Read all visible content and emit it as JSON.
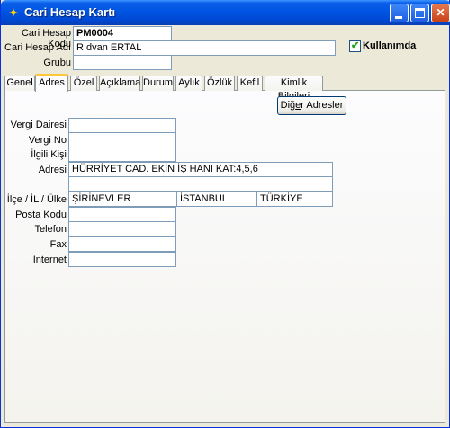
{
  "window": {
    "title": "Cari Hesap Kartı"
  },
  "header": {
    "code_label": "Cari Hesap Kodu",
    "code_value": "PM0004",
    "name_label": "Cari Hesap Adı",
    "name_value": "Rıdvan ERTAL",
    "group_label": "Grubu",
    "group_value": "",
    "active_label": "Kullanımda",
    "active_checked": true
  },
  "tabs": [
    {
      "label": "Genel",
      "active": false
    },
    {
      "label": "Adres",
      "active": true
    },
    {
      "label": "Özel",
      "active": false
    },
    {
      "label": "Açıklama",
      "active": false
    },
    {
      "label": "Durum",
      "active": false
    },
    {
      "label": "Aylık",
      "active": false
    },
    {
      "label": "Özlük",
      "active": false
    },
    {
      "label": "Kefil",
      "active": false
    },
    {
      "label": "Kimlik Bilgileri",
      "active": false
    }
  ],
  "address": {
    "other_addresses_button_prefix": "Diğ",
    "other_addresses_button_underlined": "e",
    "other_addresses_button_suffix": "r Adresler",
    "tax_office_label": "Vergi Dairesi",
    "tax_office_value": "",
    "tax_no_label": "Vergi No",
    "tax_no_value": "",
    "contact_label": "İlgili Kişi",
    "contact_value": "",
    "address_label": "Adresi",
    "address_line1": "HÜRRİYET CAD. EKİN İŞ HANI KAT:4,5,6",
    "address_line2": "",
    "region_label": "İlçe / İL / Ülke",
    "district_value": "ŞİRİNEVLER",
    "city_value": "İSTANBUL",
    "country_value": "TÜRKİYE",
    "postal_label": "Posta Kodu",
    "postal_value": "",
    "phone_label": "Telefon",
    "phone_value": "",
    "fax_label": "Fax",
    "fax_value": "",
    "internet_label": "Internet",
    "internet_value": ""
  }
}
